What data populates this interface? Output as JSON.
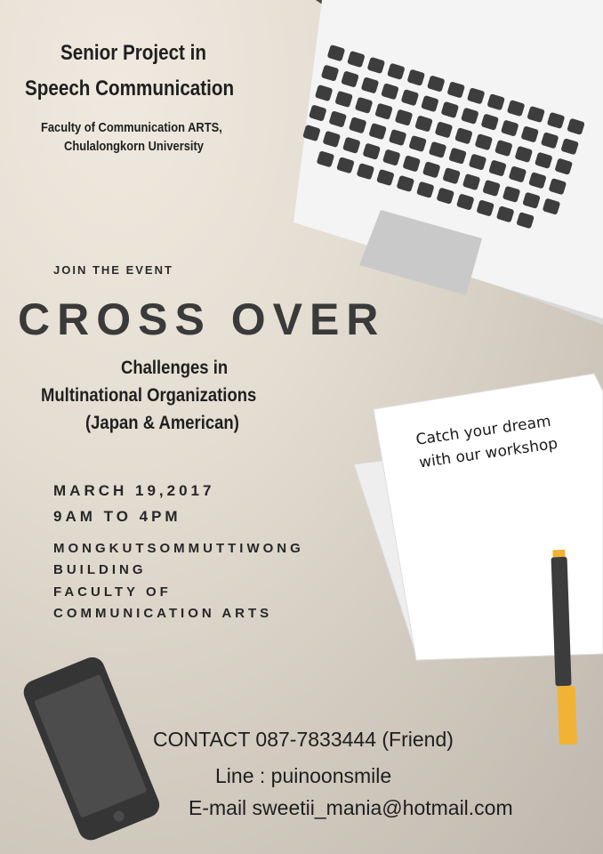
{
  "header": {
    "title_line1": "Senior Project in",
    "title_line2": "Speech Communication",
    "faculty_line1": "Faculty of Communication ARTS,",
    "faculty_line2": "Chulalongkorn University"
  },
  "event": {
    "join_label": "JOIN THE EVENT",
    "name": "CROSS OVER",
    "subtitle_line1": "Challenges in",
    "subtitle_line2": "Multinational Organizations",
    "subtitle_line3": "(Japan & American)"
  },
  "schedule": {
    "date": "MARCH 19,2017",
    "time": "9AM TO 4PM",
    "location_line1": "MONGKUTSOMMUTTIWONG",
    "location_line2": "BUILDING",
    "location_line3": "FACULTY OF",
    "location_line4": "COMMUNICATION ARTS"
  },
  "note": {
    "line1": "Catch your dream",
    "line2": "with our workshop"
  },
  "contact": {
    "phone_line": "CONTACT 087-7833444 (Friend)",
    "line_id": "Line :  puinoonsmile",
    "email": "E-mail sweetii_mania@hotmail.com"
  },
  "icons": [
    "laptop-icon",
    "phone-icon",
    "paper-icon",
    "pen-icon"
  ],
  "colors": {
    "background": "#ddd6cb",
    "laptop_body": "#f3f3f3",
    "laptop_keys": "#3c3c3c",
    "phone_body": "#3b3b3b",
    "pen_tip": "#f2b233"
  }
}
